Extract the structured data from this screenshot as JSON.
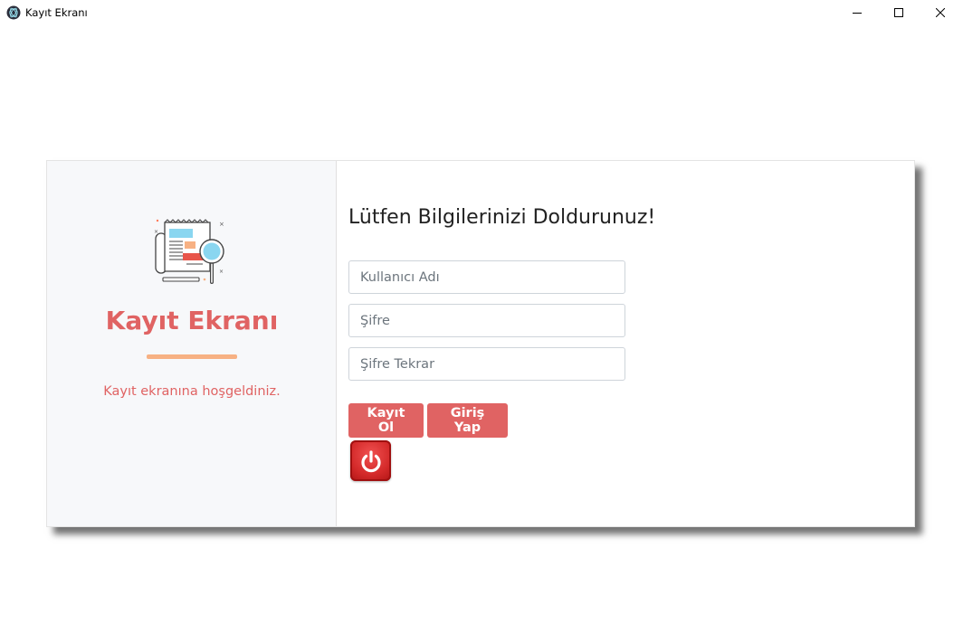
{
  "window": {
    "title": "Kayıt Ekranı",
    "controls": {
      "minimize_icon": "minimize-icon",
      "maximize_icon": "maximize-icon",
      "close_icon": "close-icon"
    }
  },
  "left_panel": {
    "illustration_icon": "newspaper-magnifier-icon",
    "title": "Kayıt Ekranı",
    "subtitle": "Kayıt ekranına hoşgeldiniz.",
    "accent_color": "#e06363",
    "divider_color": "#f7b183"
  },
  "form": {
    "heading": "Lütfen Bilgilerinizi Doldurunuz!",
    "username": {
      "placeholder": "Kullanıcı Adı",
      "value": ""
    },
    "password": {
      "placeholder": "Şifre",
      "value": ""
    },
    "password_repeat": {
      "placeholder": "Şifre Tekrar",
      "value": ""
    },
    "register_label": "Kayıt Ol",
    "login_label": "Giriş Yap",
    "power_icon": "power-icon",
    "button_color": "#e06363"
  }
}
